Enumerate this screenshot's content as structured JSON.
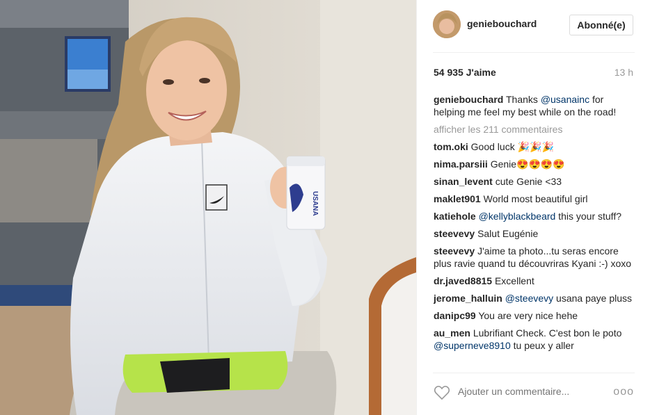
{
  "post": {
    "username": "geniebouchard",
    "follow_label": "Abonné(e)",
    "likes": "54 935 J'aime",
    "time": "13 h",
    "caption": {
      "user": "geniebouchard",
      "text_before": "Thanks ",
      "mention": "@usanainc",
      "text_after": " for helping me feel my best while on the road!"
    },
    "view_all": "afficher les 211 commentaires",
    "product_label": "USANA"
  },
  "comments": [
    {
      "user": "tom.oki",
      "text": "Good luck 🎉🎉🎉"
    },
    {
      "user": "nima.parsiii",
      "text": "Genie😍😍😍😍"
    },
    {
      "user": "sinan_levent",
      "text": "cute Genie <33"
    },
    {
      "user": "maklet901",
      "text": "World most beautiful girl"
    },
    {
      "user": "katiehole",
      "mention": "@kellyblackbeard",
      "text": " this your stuff?"
    },
    {
      "user": "steevevy",
      "text": "Salut Eugénie"
    },
    {
      "user": "steevevy",
      "text": "J'aime ta photo...tu seras encore plus ravie quand tu découvriras Kyani :-) xoxo"
    },
    {
      "user": "dr.javed8815",
      "text": "Excellent"
    },
    {
      "user": "jerome_halluin",
      "mention": "@steevevy",
      "text": " usana paye pluss"
    },
    {
      "user": "danipc99",
      "text": "You are very nice hehe"
    },
    {
      "user": "au_men",
      "text": "Lubrifiant Check. C'est bon le poto ",
      "mention": "@superneve8910",
      "text_after": " tu peux y aller"
    }
  ],
  "footer": {
    "placeholder": "Ajouter un commentaire...",
    "more_dots": "ooo"
  },
  "icons": {
    "like": "heart-icon",
    "options": "more-options-icon"
  }
}
